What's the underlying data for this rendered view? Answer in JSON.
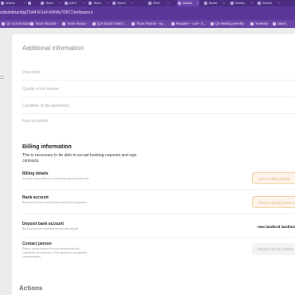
{
  "browser": {
    "tabs": [
      {
        "label": "Wunsc"
      },
      {
        "label": ""
      },
      {
        "label": "Team"
      },
      {
        "label": "[DEV"
      },
      {
        "label": "Team"
      },
      {
        "label": "Spreu"
      },
      {
        "label": "Rent"
      },
      {
        "label": "Wunsc"
      },
      {
        "label": "Booki"
      },
      {
        "label": "Wunsc"
      },
      {
        "label": "Wunsc"
      }
    ],
    "address": "s/dashboard/gjT2vM-lESnFvNhWy7D8T2Jed/payout",
    "bookmarks": [
      {
        "label": "QA Scrum Board"
      },
      {
        "label": "Team Wizards -"
      },
      {
        "label": "Team Nexus -"
      },
      {
        "label": "[QA Board Task] ti..."
      },
      {
        "label": "Team Parrots - Ap..."
      },
      {
        "label": "Request – null – S..."
      },
      {
        "label": "QA Meeting weekly"
      },
      {
        "label": "Yevenka"
      },
      {
        "label": "Users"
      }
    ]
  },
  "additional_info": {
    "title": "Additional information",
    "fields": [
      {
        "label": "Floor plan"
      },
      {
        "label": "Quality of the interior"
      },
      {
        "label": "Condition of the apartment"
      },
      {
        "label": "Keys provided"
      }
    ]
  },
  "billing": {
    "title": "Billing information",
    "description": "This is necessary to be able to accept booking requests and sign contracts",
    "rows": [
      {
        "title": "Billing details",
        "desc": "A person responsible for contract signing and payments",
        "value": "Select billing details"
      },
      {
        "title": "Bank account",
        "desc": "Bank account for receiving the monthly rent payments",
        "value": "Please specify bank account"
      },
      {
        "title": "Deposit bank account",
        "desc": "Bank account for receiving the security deposit",
        "value": "new landlord landlord"
      },
      {
        "title": "Contact person",
        "desc": "Enter a contact person for your tenants who will coordinate the handover of the apartment and general communication",
        "value": "Please specify contact person"
      }
    ]
  },
  "actions": {
    "title": "Actions"
  }
}
